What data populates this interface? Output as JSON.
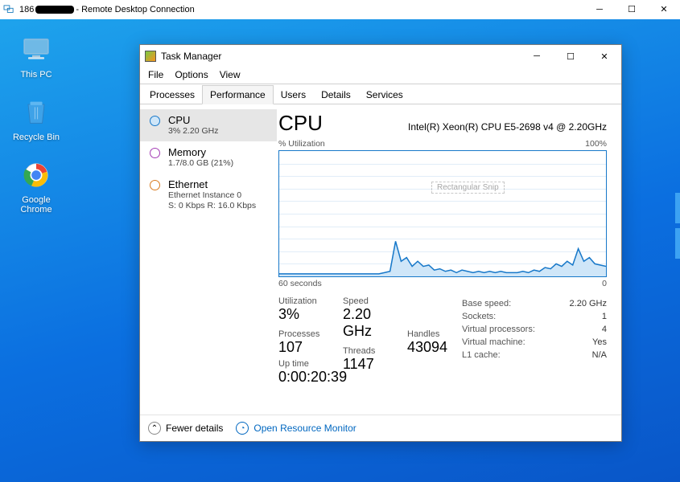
{
  "rdc": {
    "prefix": "186",
    "suffix": "- Remote Desktop Connection"
  },
  "desktop": {
    "icons": [
      {
        "name": "this-pc",
        "label": "This PC"
      },
      {
        "name": "recycle-bin",
        "label": "Recycle Bin"
      },
      {
        "name": "chrome",
        "label": "Google Chrome"
      }
    ]
  },
  "taskmgr": {
    "title": "Task Manager",
    "menu": [
      "File",
      "Options",
      "View"
    ],
    "tabs": [
      "Processes",
      "Performance",
      "Users",
      "Details",
      "Services"
    ],
    "active_tab": 1,
    "sidebar": [
      {
        "name": "cpu",
        "title": "CPU",
        "sub": "3%  2.20 GHz",
        "color": "#1778c9",
        "fill": "#cfe6f8",
        "active": true
      },
      {
        "name": "memory",
        "title": "Memory",
        "sub": "1.7/8.0 GB (21%)",
        "color": "#a43db5",
        "fill": "#fff",
        "active": false
      },
      {
        "name": "ethernet",
        "title": "Ethernet",
        "sub": "Ethernet Instance 0\nS: 0 Kbps  R: 16.0 Kbps",
        "color": "#d97b1f",
        "fill": "#fff",
        "active": false
      }
    ],
    "main": {
      "heading": "CPU",
      "subhead": "Intel(R) Xeon(R) CPU E5-2698 v4 @ 2.20GHz",
      "chart_top_left": "% Utilization",
      "chart_top_right": "100%",
      "chart_bottom_left": "60 seconds",
      "chart_bottom_right": "0",
      "stats_left": [
        {
          "label": "Utilization",
          "value": "3%"
        },
        {
          "label": "Speed",
          "value": "2.20 GHz"
        }
      ],
      "stats_row2": [
        {
          "label": "Processes",
          "value": "107"
        },
        {
          "label": "Threads",
          "value": "1147"
        },
        {
          "label": "Handles",
          "value": "43094"
        }
      ],
      "uptime_label": "Up time",
      "uptime_value": "0:00:20:39",
      "right": [
        {
          "k": "Base speed:",
          "v": "2.20 GHz"
        },
        {
          "k": "Sockets:",
          "v": "1"
        },
        {
          "k": "Virtual processors:",
          "v": "4"
        },
        {
          "k": "Virtual machine:",
          "v": "Yes"
        },
        {
          "k": "L1 cache:",
          "v": "N/A"
        }
      ]
    },
    "footer": {
      "fewer": "Fewer details",
      "orm": "Open Resource Monitor"
    }
  },
  "snip": "Rectangular Snip",
  "chart_data": {
    "type": "line",
    "title": "% Utilization",
    "xlabel": "60 seconds",
    "ylabel": "",
    "ylim": [
      0,
      100
    ],
    "xrange_seconds": 60,
    "series": [
      {
        "name": "CPU %",
        "values": [
          2,
          2,
          2,
          2,
          2,
          2,
          2,
          2,
          2,
          2,
          2,
          2,
          2,
          2,
          2,
          2,
          2,
          2,
          2,
          3,
          4,
          28,
          12,
          15,
          8,
          12,
          8,
          9,
          5,
          6,
          4,
          5,
          3,
          5,
          4,
          3,
          4,
          3,
          4,
          3,
          4,
          3,
          3,
          3,
          4,
          3,
          5,
          4,
          7,
          6,
          10,
          8,
          12,
          9,
          22,
          12,
          15,
          10,
          9,
          8
        ]
      }
    ]
  }
}
